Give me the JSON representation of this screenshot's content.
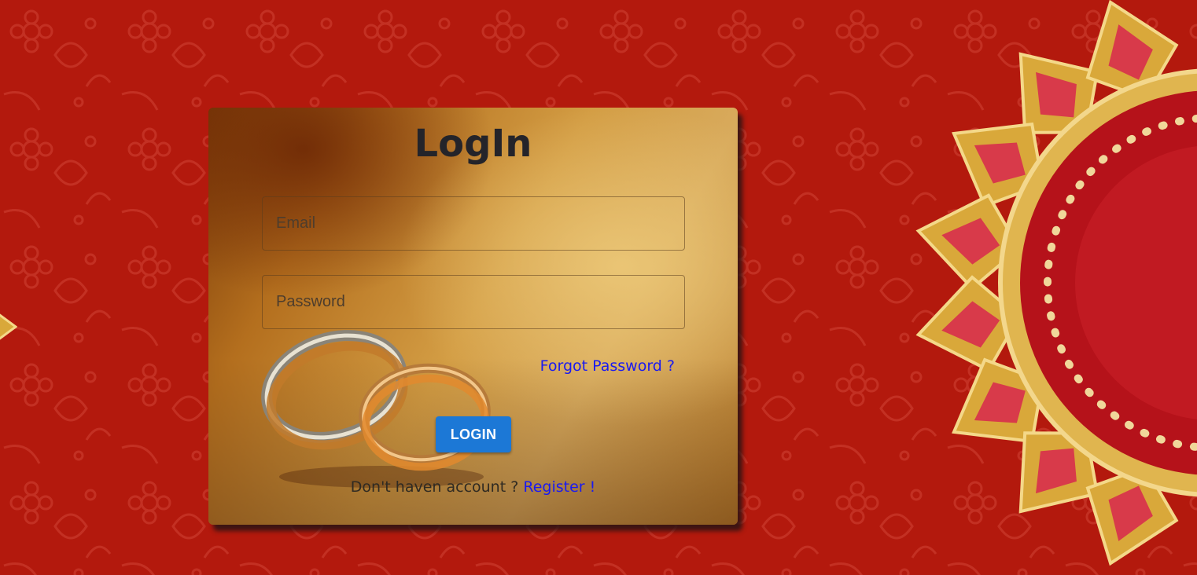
{
  "login": {
    "title": "LogIn",
    "email_placeholder": "Email",
    "password_placeholder": "Password",
    "forgot_password": "Forgot Password ?",
    "login_button": "LOGIN",
    "no_account_text": "Don't haven account ?",
    "register_link": "Register !"
  },
  "colors": {
    "background": "#b3190d",
    "link": "#1a1af0",
    "button": "#1c78d6",
    "title": "#24242a"
  },
  "icons": {
    "background_decoration": "mandala-ornament",
    "card_image": "wedding-rings"
  }
}
